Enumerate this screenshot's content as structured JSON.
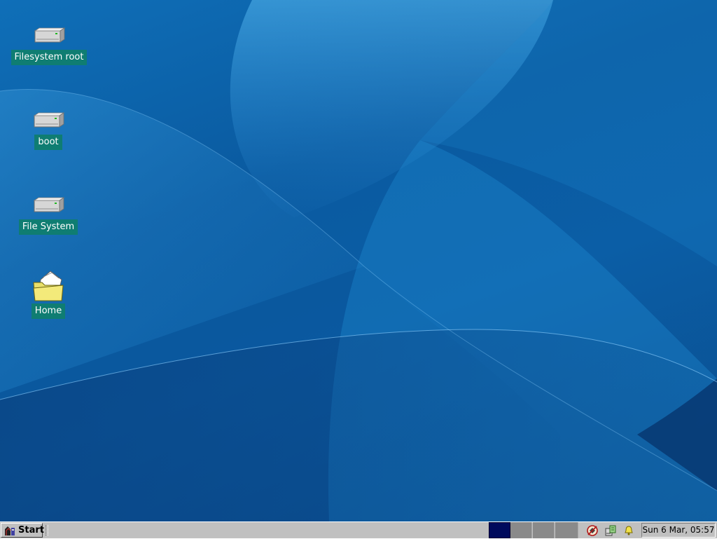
{
  "desktop": {
    "icons": [
      {
        "label": "Filesystem root",
        "icon": "drive-icon"
      },
      {
        "label": "boot",
        "icon": "drive-icon"
      },
      {
        "label": "File System",
        "icon": "drive-icon"
      },
      {
        "label": "Home",
        "icon": "folder-icon"
      }
    ],
    "label_bg": "#0f7d72"
  },
  "taskbar": {
    "start_label": "Start",
    "pager": {
      "desktops": 4,
      "active": 1,
      "active_color": "#000a5c"
    },
    "tray_icons": [
      "network-icon",
      "package-updates-icon",
      "notification-bell-icon"
    ],
    "clock": "Sun  6 Mar, 05:57"
  }
}
